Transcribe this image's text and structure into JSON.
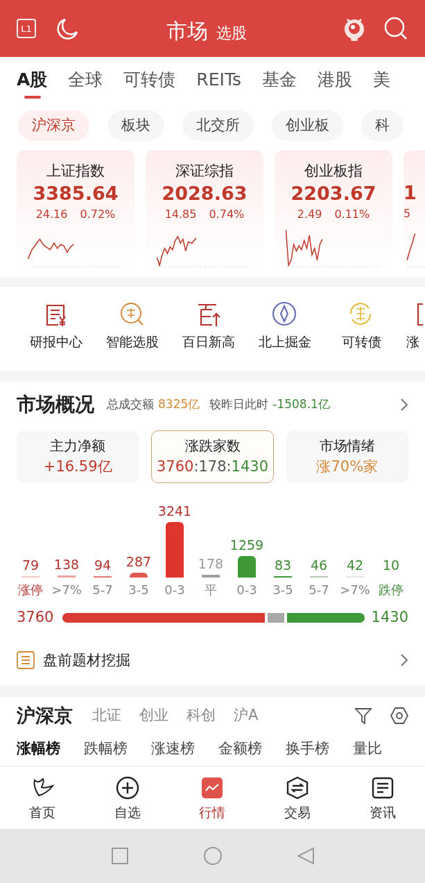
{
  "header": {
    "title": "市场",
    "subtitle": "选股",
    "level_badge": "L1"
  },
  "tabs": [
    {
      "label": "A股",
      "selected": true
    },
    {
      "label": "全球",
      "selected": false
    },
    {
      "label": "可转债",
      "selected": false
    },
    {
      "label": "REITs",
      "selected": false
    },
    {
      "label": "基金",
      "selected": false
    },
    {
      "label": "港股",
      "selected": false
    },
    {
      "label": "美",
      "selected": false
    }
  ],
  "chips": [
    {
      "label": "沪深京",
      "selected": true
    },
    {
      "label": "板块",
      "selected": false
    },
    {
      "label": "北交所",
      "selected": false
    },
    {
      "label": "创业板",
      "selected": false
    },
    {
      "label": "科",
      "selected": false
    }
  ],
  "index_cards": [
    {
      "name": "上证指数",
      "value": "3385.64",
      "change": "24.16",
      "percent": "0.72%"
    },
    {
      "name": "深证综指",
      "value": "2028.63",
      "change": "14.85",
      "percent": "0.74%"
    },
    {
      "name": "创业板指",
      "value": "2203.67",
      "change": "2.49",
      "percent": "0.11%"
    },
    {
      "value": "1",
      "change": "5"
    }
  ],
  "shortcuts": [
    {
      "kind": "report",
      "label": "研报中心"
    },
    {
      "kind": "pick",
      "label": "智能选股"
    },
    {
      "kind": "high",
      "label": "百日新高"
    },
    {
      "kind": "north",
      "label": "北上掘金"
    },
    {
      "kind": "bond",
      "label": "可转债"
    },
    {
      "kind": "limit",
      "label": "涨"
    }
  ],
  "overview": {
    "title": "市场概况",
    "turnover_label": "总成交额",
    "turnover": "8325亿",
    "compare_label": "较昨日此时",
    "compare": "-1508.1亿",
    "stats": [
      {
        "label": "主力净额",
        "value": "+16.59亿",
        "selected": false,
        "kind": "up"
      },
      {
        "label": "涨跌家数",
        "value_parts": [
          "3760",
          ":178:",
          "1430"
        ],
        "selected": true,
        "kind": "ratio"
      },
      {
        "label": "市场情绪",
        "value": "涨70%家",
        "selected": false,
        "kind": "mood"
      }
    ],
    "distribution": [
      {
        "count": "79",
        "label": "涨停",
        "kind": "up",
        "color": "#f3c7c3"
      },
      {
        "count": "138",
        "label": ">7%",
        "kind": "up",
        "color": "#eda3a0"
      },
      {
        "count": "94",
        "label": "5-7",
        "kind": "up",
        "color": "#e07a75"
      },
      {
        "count": "287",
        "label": "3-5",
        "kind": "up",
        "color": "#e05a52"
      },
      {
        "count": "3241",
        "label": "0-3",
        "kind": "up",
        "color": "#e0352d"
      },
      {
        "count": "178",
        "label": "平",
        "kind": "flat",
        "color": "#a0a0a0"
      },
      {
        "count": "1259",
        "label": "0-3",
        "kind": "down",
        "color": "#3e9a36"
      },
      {
        "count": "83",
        "label": "3-5",
        "kind": "down",
        "color": "#3e9a36"
      },
      {
        "count": "46",
        "label": "5-7",
        "kind": "down",
        "color": "#b7c9b4"
      },
      {
        "count": "42",
        "label": ">7%",
        "kind": "down",
        "color": "#e3e9e2"
      },
      {
        "count": "10",
        "label": "跌停",
        "kind": "down"
      }
    ],
    "breadth": {
      "up": "3760",
      "down": "1430"
    },
    "topic_link": "盘前题材挖掘"
  },
  "list_section": {
    "title": "沪深京",
    "markets": [
      "北证",
      "创业",
      "科创",
      "沪A"
    ],
    "rankings": [
      {
        "label": "涨幅榜",
        "selected": true
      },
      {
        "label": "跌幅榜",
        "selected": false
      },
      {
        "label": "涨速榜",
        "selected": false
      },
      {
        "label": "金额榜",
        "selected": false
      },
      {
        "label": "换手榜",
        "selected": false
      },
      {
        "label": "量比",
        "selected": false
      }
    ]
  },
  "bottom_nav": [
    {
      "kind": "home",
      "label": "首页",
      "selected": false
    },
    {
      "kind": "watch",
      "label": "自选",
      "selected": false
    },
    {
      "kind": "market",
      "label": "行情",
      "selected": true
    },
    {
      "kind": "trade",
      "label": "交易",
      "selected": false
    },
    {
      "kind": "news",
      "label": "资讯",
      "selected": false
    }
  ]
}
